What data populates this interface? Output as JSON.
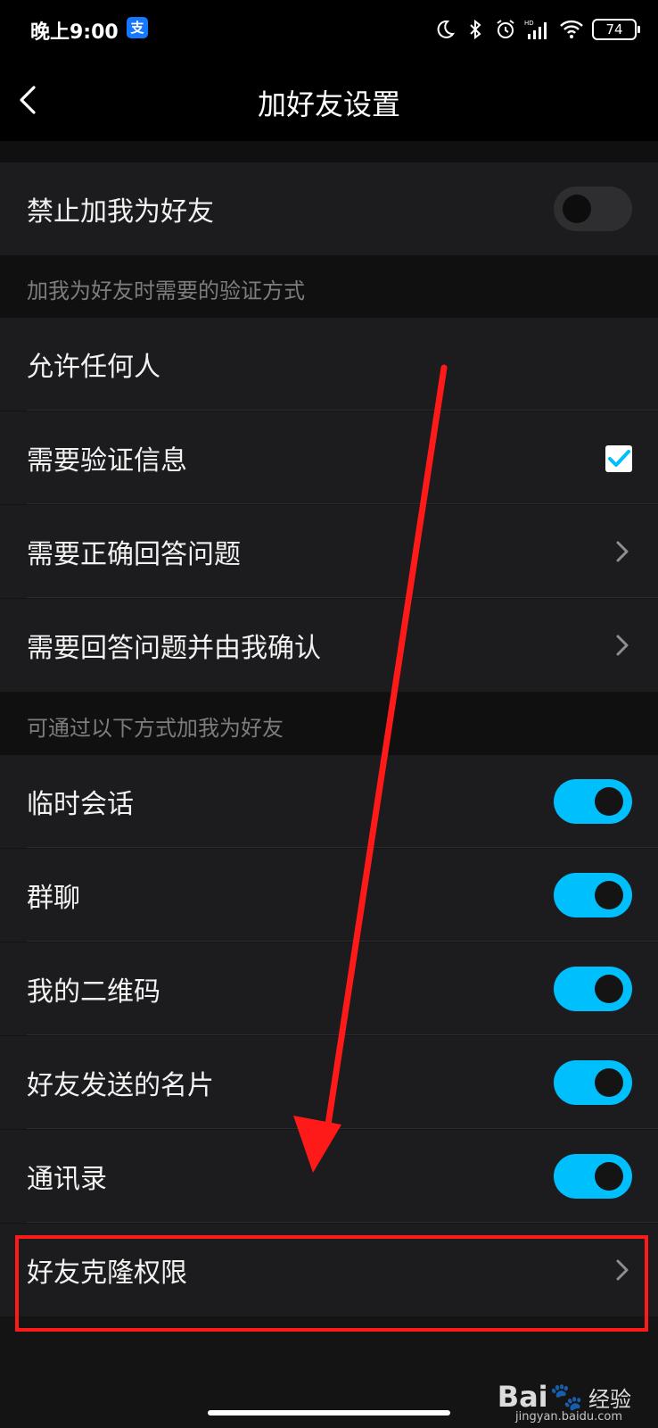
{
  "status_bar": {
    "time": "晚上9:00",
    "app_icon_glyph": "支",
    "battery": "74",
    "icons": [
      "moon-icon",
      "bluetooth-icon",
      "alarm-icon",
      "hd-signal-icon",
      "wifi-icon",
      "battery-icon"
    ]
  },
  "nav": {
    "title": "加好友设置",
    "back_icon": "chevron-left-icon"
  },
  "block_friend_request": {
    "label": "禁止加我为好友",
    "toggle": "off"
  },
  "verification_section": {
    "header": "加我为好友时需要的验证方式",
    "items": [
      {
        "label": "允许任何人",
        "control": "none"
      },
      {
        "label": "需要验证信息",
        "control": "check",
        "checked": true
      },
      {
        "label": "需要正确回答问题",
        "control": "chevron"
      },
      {
        "label": "需要回答问题并由我确认",
        "control": "chevron"
      }
    ]
  },
  "methods_section": {
    "header": "可通过以下方式加我为好友",
    "items": [
      {
        "label": "临时会话",
        "toggle": "on"
      },
      {
        "label": "群聊",
        "toggle": "on"
      },
      {
        "label": "我的二维码",
        "toggle": "on"
      },
      {
        "label": "好友发送的名片",
        "toggle": "on"
      },
      {
        "label": "通讯录",
        "toggle": "on"
      }
    ]
  },
  "clone_permission": {
    "label": "好友克隆权限"
  },
  "watermark": {
    "brand_left": "Bai",
    "brand_paw": "🐾",
    "brand_cn": "经验",
    "url": "jingyan.baidu.com"
  },
  "colors": {
    "accent_toggle": "#00bffd",
    "highlight": "#ff1a1a",
    "background": "#141414",
    "row_bg": "#1c1c1e"
  }
}
